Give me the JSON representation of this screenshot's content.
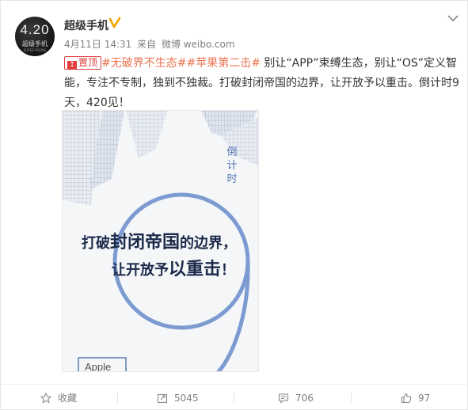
{
  "user": {
    "name": "超级手机",
    "avatar_big": "4.20",
    "avatar_small": "超级手机",
    "avatar_tiny": "SUPER PHONE"
  },
  "meta": {
    "date": "4月11日 14:31",
    "source_prefix": "来自",
    "source": "微博 weibo.com"
  },
  "post": {
    "pin_label": "置顶",
    "tag1": "#无破界不生态#",
    "tag2": "#苹果第二击#",
    "body": " 别让“APP”束缚生态，别让“OS”定义智能，专注不专制，独到不独裁。打破封闭帝国的边界，让开放予以重击。倒计时9天，420见！"
  },
  "poster": {
    "vertical_text": "倒计时",
    "slogan_line1_a": "打破",
    "slogan_line1_b": "封闭帝国",
    "slogan_line1_c": "的边界，",
    "slogan_line2_a": "让开放予",
    "slogan_line2_b": "以重击",
    "slogan_line2_c": "！",
    "brand": "Apple",
    "accent_color": "#7c9bd1"
  },
  "actions": {
    "favorite_label": "收藏",
    "repost_count": "5045",
    "comment_count": "706",
    "like_count": "97"
  }
}
